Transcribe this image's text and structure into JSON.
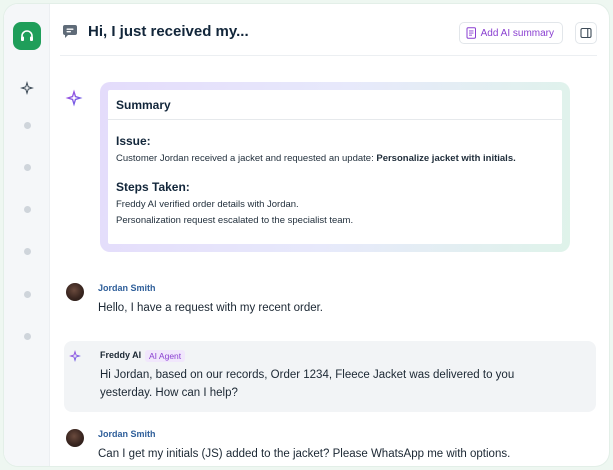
{
  "header": {
    "title": "Hi, I just received my...",
    "ai_summary_label": "Add AI summary"
  },
  "summary": {
    "title": "Summary",
    "issue_heading": "Issue:",
    "issue_text": "Customer Jordan received a jacket and requested an update: ",
    "issue_emphasis": "Personalize jacket with initials.",
    "steps_heading": "Steps Taken:",
    "steps": [
      "Freddy AI verified order details with Jordan.",
      "Personalization request escalated to the specialist team."
    ]
  },
  "messages": [
    {
      "sender": "Jordan Smith",
      "text": "Hello, I have a request with my recent order."
    },
    {
      "sender": "Freddy AI",
      "badge": "AI Agent",
      "lines": [
        "Hi Jordan, based on our records, Order 1234, Fleece Jacket was delivered to you",
        "yesterday. How can I help?"
      ]
    },
    {
      "sender": "Jordan Smith",
      "text": "Can I get my initials (JS) added to the jacket? Please WhatsApp me with options."
    }
  ],
  "colors": {
    "brand_green": "#1f9e5a",
    "ai_purple": "#8a3fd1",
    "sender_blue": "#2f5f9a"
  },
  "icons": {
    "app": "headset-icon",
    "rail_ai": "sparkle-icon",
    "chat": "chat-bubble-icon",
    "ai_summary": "document-icon",
    "panel": "side-panel-icon"
  }
}
